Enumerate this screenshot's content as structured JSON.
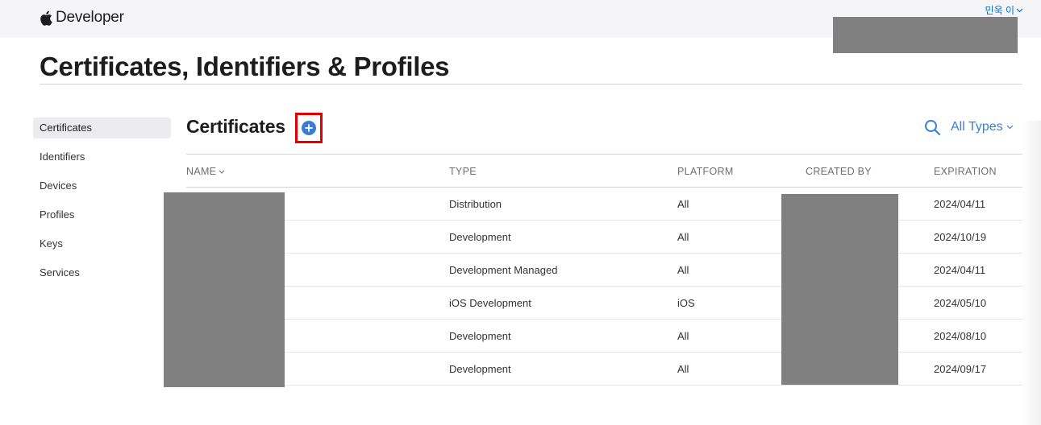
{
  "header": {
    "brand": "Developer",
    "account_name": "민욱 이"
  },
  "page": {
    "title": "Certificates, Identifiers & Profiles"
  },
  "sidebar": {
    "items": [
      {
        "label": "Certificates",
        "active": true
      },
      {
        "label": "Identifiers",
        "active": false
      },
      {
        "label": "Devices",
        "active": false
      },
      {
        "label": "Profiles",
        "active": false
      },
      {
        "label": "Keys",
        "active": false
      },
      {
        "label": "Services",
        "active": false
      }
    ]
  },
  "section": {
    "title": "Certificates",
    "filter_label": "All Types",
    "icons": {
      "add": "plus-circle-icon",
      "search": "search-icon",
      "chevron": "chevron-down-icon"
    },
    "accent_color": "#3a7ed4",
    "highlight_color": "#e00000"
  },
  "table": {
    "columns": [
      "NAME",
      "TYPE",
      "PLATFORM",
      "CREATED BY",
      "EXPIRATION"
    ],
    "rows": [
      {
        "type": "Distribution",
        "platform": "All",
        "expiration": "2024/04/11"
      },
      {
        "type": "Development",
        "platform": "All",
        "expiration": "2024/10/19"
      },
      {
        "type": "Development Managed",
        "platform": "All",
        "expiration": "2024/04/11"
      },
      {
        "type": "iOS Development",
        "platform": "iOS",
        "expiration": "2024/05/10"
      },
      {
        "type": "Development",
        "platform": "All",
        "expiration": "2024/08/10"
      },
      {
        "type": "Development",
        "platform": "All",
        "expiration": "2024/09/17"
      }
    ]
  }
}
